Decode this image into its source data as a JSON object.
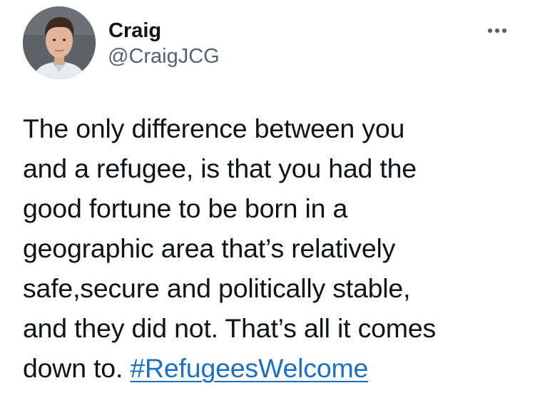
{
  "author": {
    "display_name": "Craig",
    "handle": "@CraigJCG",
    "avatar_icon": "user-avatar"
  },
  "menu": {
    "icon": "more-horizontal-icon"
  },
  "tweet": {
    "lines": [
      "The only difference between you",
      "and a refugee, is that you had the",
      "good fortune to be born in a",
      "geographic area that’s relatively",
      "safe,secure and politically stable,",
      "and they did not. That’s all it comes"
    ],
    "last_line_text": "down to.",
    "hashtag": "#RefugeesWelcome"
  },
  "colors": {
    "text": "#0f1419",
    "secondary": "#536471",
    "link": "#1d6fc1"
  }
}
